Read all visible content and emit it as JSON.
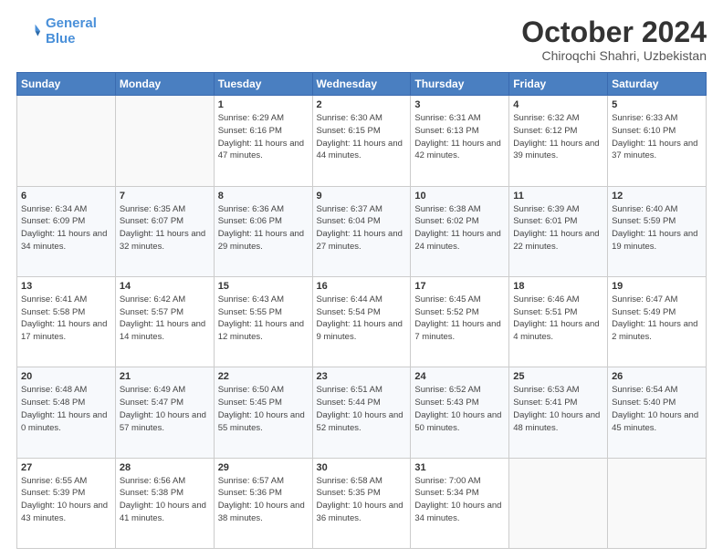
{
  "header": {
    "logo_line1": "General",
    "logo_line2": "Blue",
    "month": "October 2024",
    "location": "Chiroqchi Shahri, Uzbekistan"
  },
  "weekdays": [
    "Sunday",
    "Monday",
    "Tuesday",
    "Wednesday",
    "Thursday",
    "Friday",
    "Saturday"
  ],
  "weeks": [
    [
      {
        "day": "",
        "info": ""
      },
      {
        "day": "",
        "info": ""
      },
      {
        "day": "1",
        "info": "Sunrise: 6:29 AM\nSunset: 6:16 PM\nDaylight: 11 hours and 47 minutes."
      },
      {
        "day": "2",
        "info": "Sunrise: 6:30 AM\nSunset: 6:15 PM\nDaylight: 11 hours and 44 minutes."
      },
      {
        "day": "3",
        "info": "Sunrise: 6:31 AM\nSunset: 6:13 PM\nDaylight: 11 hours and 42 minutes."
      },
      {
        "day": "4",
        "info": "Sunrise: 6:32 AM\nSunset: 6:12 PM\nDaylight: 11 hours and 39 minutes."
      },
      {
        "day": "5",
        "info": "Sunrise: 6:33 AM\nSunset: 6:10 PM\nDaylight: 11 hours and 37 minutes."
      }
    ],
    [
      {
        "day": "6",
        "info": "Sunrise: 6:34 AM\nSunset: 6:09 PM\nDaylight: 11 hours and 34 minutes."
      },
      {
        "day": "7",
        "info": "Sunrise: 6:35 AM\nSunset: 6:07 PM\nDaylight: 11 hours and 32 minutes."
      },
      {
        "day": "8",
        "info": "Sunrise: 6:36 AM\nSunset: 6:06 PM\nDaylight: 11 hours and 29 minutes."
      },
      {
        "day": "9",
        "info": "Sunrise: 6:37 AM\nSunset: 6:04 PM\nDaylight: 11 hours and 27 minutes."
      },
      {
        "day": "10",
        "info": "Sunrise: 6:38 AM\nSunset: 6:02 PM\nDaylight: 11 hours and 24 minutes."
      },
      {
        "day": "11",
        "info": "Sunrise: 6:39 AM\nSunset: 6:01 PM\nDaylight: 11 hours and 22 minutes."
      },
      {
        "day": "12",
        "info": "Sunrise: 6:40 AM\nSunset: 5:59 PM\nDaylight: 11 hours and 19 minutes."
      }
    ],
    [
      {
        "day": "13",
        "info": "Sunrise: 6:41 AM\nSunset: 5:58 PM\nDaylight: 11 hours and 17 minutes."
      },
      {
        "day": "14",
        "info": "Sunrise: 6:42 AM\nSunset: 5:57 PM\nDaylight: 11 hours and 14 minutes."
      },
      {
        "day": "15",
        "info": "Sunrise: 6:43 AM\nSunset: 5:55 PM\nDaylight: 11 hours and 12 minutes."
      },
      {
        "day": "16",
        "info": "Sunrise: 6:44 AM\nSunset: 5:54 PM\nDaylight: 11 hours and 9 minutes."
      },
      {
        "day": "17",
        "info": "Sunrise: 6:45 AM\nSunset: 5:52 PM\nDaylight: 11 hours and 7 minutes."
      },
      {
        "day": "18",
        "info": "Sunrise: 6:46 AM\nSunset: 5:51 PM\nDaylight: 11 hours and 4 minutes."
      },
      {
        "day": "19",
        "info": "Sunrise: 6:47 AM\nSunset: 5:49 PM\nDaylight: 11 hours and 2 minutes."
      }
    ],
    [
      {
        "day": "20",
        "info": "Sunrise: 6:48 AM\nSunset: 5:48 PM\nDaylight: 11 hours and 0 minutes."
      },
      {
        "day": "21",
        "info": "Sunrise: 6:49 AM\nSunset: 5:47 PM\nDaylight: 10 hours and 57 minutes."
      },
      {
        "day": "22",
        "info": "Sunrise: 6:50 AM\nSunset: 5:45 PM\nDaylight: 10 hours and 55 minutes."
      },
      {
        "day": "23",
        "info": "Sunrise: 6:51 AM\nSunset: 5:44 PM\nDaylight: 10 hours and 52 minutes."
      },
      {
        "day": "24",
        "info": "Sunrise: 6:52 AM\nSunset: 5:43 PM\nDaylight: 10 hours and 50 minutes."
      },
      {
        "day": "25",
        "info": "Sunrise: 6:53 AM\nSunset: 5:41 PM\nDaylight: 10 hours and 48 minutes."
      },
      {
        "day": "26",
        "info": "Sunrise: 6:54 AM\nSunset: 5:40 PM\nDaylight: 10 hours and 45 minutes."
      }
    ],
    [
      {
        "day": "27",
        "info": "Sunrise: 6:55 AM\nSunset: 5:39 PM\nDaylight: 10 hours and 43 minutes."
      },
      {
        "day": "28",
        "info": "Sunrise: 6:56 AM\nSunset: 5:38 PM\nDaylight: 10 hours and 41 minutes."
      },
      {
        "day": "29",
        "info": "Sunrise: 6:57 AM\nSunset: 5:36 PM\nDaylight: 10 hours and 38 minutes."
      },
      {
        "day": "30",
        "info": "Sunrise: 6:58 AM\nSunset: 5:35 PM\nDaylight: 10 hours and 36 minutes."
      },
      {
        "day": "31",
        "info": "Sunrise: 7:00 AM\nSunset: 5:34 PM\nDaylight: 10 hours and 34 minutes."
      },
      {
        "day": "",
        "info": ""
      },
      {
        "day": "",
        "info": ""
      }
    ]
  ]
}
